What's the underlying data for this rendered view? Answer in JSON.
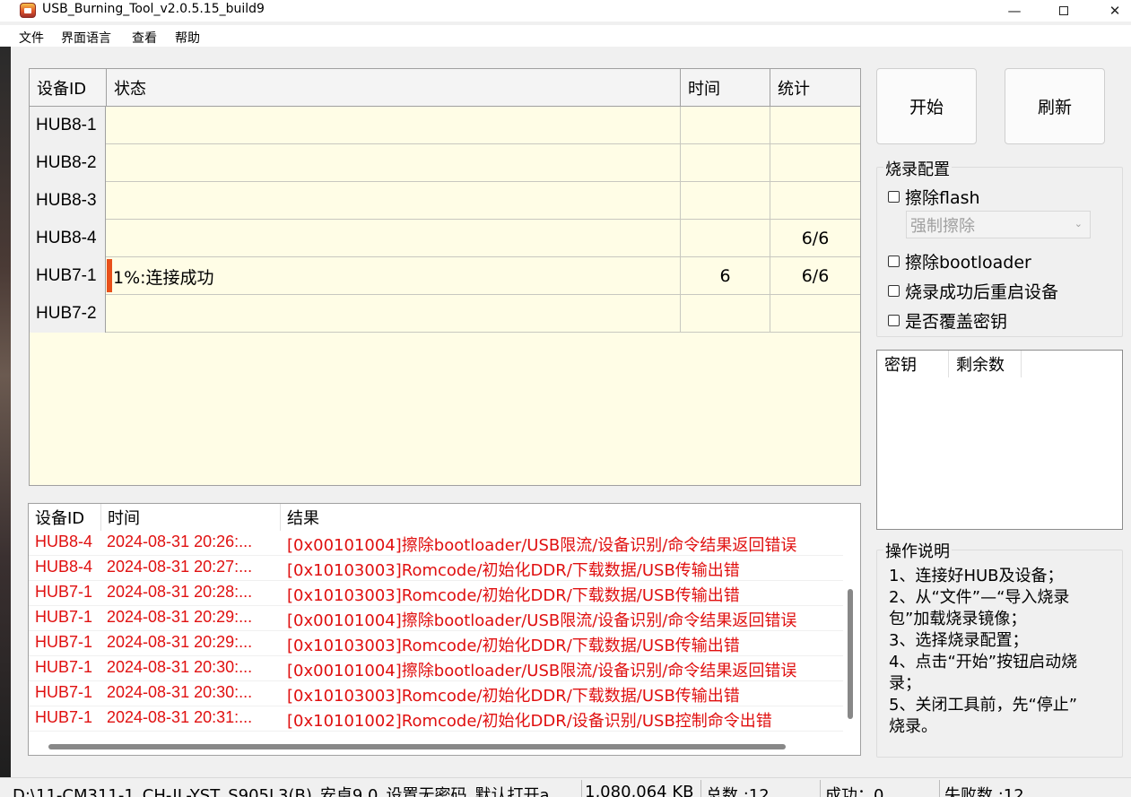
{
  "window": {
    "title": "USB_Burning_Tool_v2.0.5.15_build9",
    "minimize_glyph": "—",
    "close_glyph": "✕"
  },
  "menu": {
    "items": [
      "文件",
      "界面语言",
      "查看",
      "帮助"
    ]
  },
  "device_table": {
    "columns": [
      "设备ID",
      "状态",
      "时间",
      "统计"
    ],
    "rows": [
      {
        "id": "HUB8-1",
        "status": "",
        "time": "",
        "stat": "",
        "progress": 0
      },
      {
        "id": "HUB8-2",
        "status": "",
        "time": "",
        "stat": "",
        "progress": 0
      },
      {
        "id": "HUB8-3",
        "status": "",
        "time": "",
        "stat": "",
        "progress": 0
      },
      {
        "id": "HUB8-4",
        "status": "",
        "time": "",
        "stat": "6/6",
        "progress": 0
      },
      {
        "id": "HUB7-1",
        "status": "1%:连接成功",
        "time": "6",
        "stat": "6/6",
        "progress": 0.01
      },
      {
        "id": "HUB7-2",
        "status": "",
        "time": "",
        "stat": "",
        "progress": 0
      }
    ],
    "progress_color": "#e8501a",
    "background_color": "#fffde6"
  },
  "log_table": {
    "columns": [
      "设备ID",
      "时间",
      "结果"
    ],
    "rows": [
      {
        "id": "HUB8-4",
        "time": "2024-08-31 20:26:...",
        "result": "[0x00101004]擦除bootloader/USB限流/设备识别/命令结果返回错误"
      },
      {
        "id": "HUB8-4",
        "time": "2024-08-31 20:27:...",
        "result": "[0x10103003]Romcode/初始化DDR/下载数据/USB传输出错"
      },
      {
        "id": "HUB7-1",
        "time": "2024-08-31 20:28:...",
        "result": "[0x10103003]Romcode/初始化DDR/下载数据/USB传输出错"
      },
      {
        "id": "HUB7-1",
        "time": "2024-08-31 20:29:...",
        "result": "[0x00101004]擦除bootloader/USB限流/设备识别/命令结果返回错误"
      },
      {
        "id": "HUB7-1",
        "time": "2024-08-31 20:29:...",
        "result": "[0x10103003]Romcode/初始化DDR/下载数据/USB传输出错"
      },
      {
        "id": "HUB7-1",
        "time": "2024-08-31 20:30:...",
        "result": "[0x00101004]擦除bootloader/USB限流/设备识别/命令结果返回错误"
      },
      {
        "id": "HUB7-1",
        "time": "2024-08-31 20:30:...",
        "result": "[0x10103003]Romcode/初始化DDR/下载数据/USB传输出错"
      },
      {
        "id": "HUB7-1",
        "time": "2024-08-31 20:31:...",
        "result": "[0x10101002]Romcode/初始化DDR/设备识别/USB控制命令出错"
      }
    ],
    "error_color": "#e01010"
  },
  "buttons": {
    "start": "开始",
    "refresh": "刷新"
  },
  "burn_config": {
    "title": "烧录配置",
    "erase_flash": {
      "label": "擦除flash",
      "checked": false
    },
    "erase_mode": {
      "value": "强制擦除",
      "disabled": true
    },
    "erase_bootloader": {
      "label": "擦除bootloader",
      "checked": false
    },
    "reboot_after": {
      "label": "烧录成功后重启设备",
      "checked": false
    },
    "overwrite_key": {
      "label": "是否覆盖密钥",
      "checked": false
    }
  },
  "key_list": {
    "columns": [
      "密钥",
      "剩余数"
    ]
  },
  "instructions": {
    "title": "操作说明",
    "lines": [
      "1、连接好HUB及设备；",
      "2、从“文件”—“导入烧录",
      "包”加载烧录镜像；",
      "3、选择烧录配置；",
      "4、点击“开始”按钮启动烧",
      "录；",
      "5、关闭工具前，先“停止”",
      "烧录。"
    ]
  },
  "statusbar": {
    "image_path": "D:\\11-CM311-1_CH-JL-YST_S905L3(B)_安卓9.0_设置无密码_默认打开a",
    "image_size": "1,080,064 KB",
    "total": "总数 :12",
    "success": "成功：0",
    "failed": "失败数 :12"
  }
}
